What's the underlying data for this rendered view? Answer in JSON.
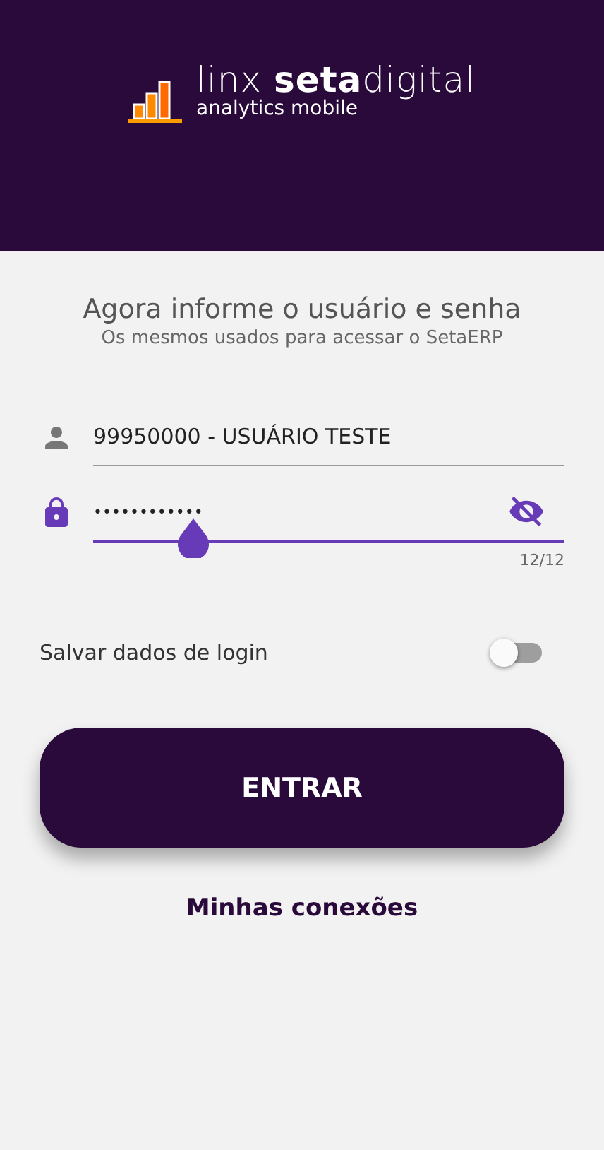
{
  "logo": {
    "brand": "linx",
    "product_bold": "seta",
    "product_light": "digital",
    "tagline": "analytics mobile"
  },
  "heading": {
    "title": "Agora informe o usuário e senha",
    "subtitle": "Os mesmos usados para acessar o SetaERP"
  },
  "username": {
    "value": "99950000 - USUÁRIO TESTE"
  },
  "password": {
    "value": "••••••••••••",
    "focused": true,
    "visible": false,
    "counter": "12/12"
  },
  "save_login": {
    "label": "Salvar dados de login",
    "on": false
  },
  "login_button": {
    "label": "ENTRAR"
  },
  "connections_link": {
    "label": "Minhas conexões"
  }
}
